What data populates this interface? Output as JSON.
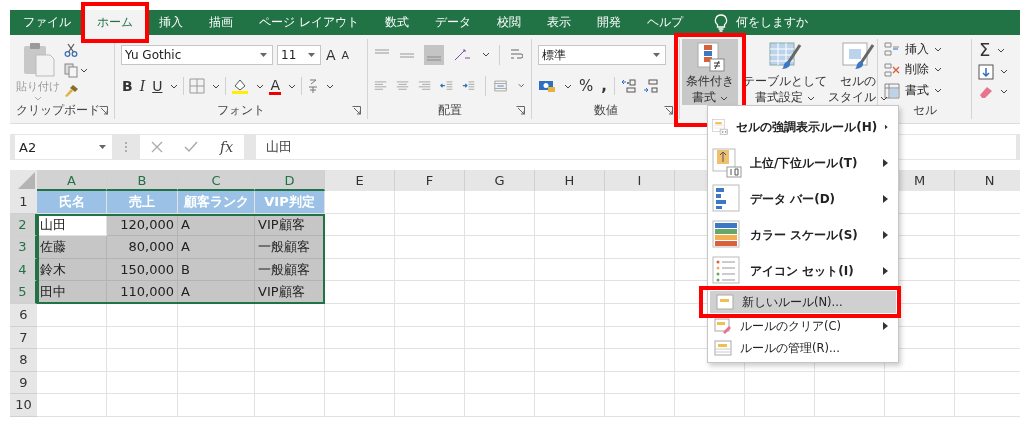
{
  "tabs": [
    {
      "label": "ファイル",
      "selected": false,
      "highlighted": false
    },
    {
      "label": "ホーム",
      "selected": true,
      "highlighted": true
    },
    {
      "label": "挿入",
      "selected": false,
      "highlighted": false
    },
    {
      "label": "描画",
      "selected": false,
      "highlighted": false
    },
    {
      "label": "ページ レイアウト",
      "selected": false,
      "highlighted": false
    },
    {
      "label": "数式",
      "selected": false,
      "highlighted": false
    },
    {
      "label": "データ",
      "selected": false,
      "highlighted": false
    },
    {
      "label": "校閲",
      "selected": false,
      "highlighted": false
    },
    {
      "label": "表示",
      "selected": false,
      "highlighted": false
    },
    {
      "label": "開発",
      "selected": false,
      "highlighted": false
    },
    {
      "label": "ヘルプ",
      "selected": false,
      "highlighted": false
    }
  ],
  "tell_me": "何をしますか",
  "ribbon": {
    "clipboard": {
      "paste": "貼り付け",
      "label": "クリップボード"
    },
    "font": {
      "name": "Yu Gothic",
      "size": "11",
      "grow": "A",
      "shrink": "A",
      "bold": "B",
      "italic": "I",
      "underline": "U",
      "font_color": "A",
      "label": "フォント"
    },
    "alignment": {
      "label": "配置"
    },
    "number": {
      "format": "標準",
      "percent": "%",
      "comma": ",",
      "label": "数値"
    },
    "styles": [
      {
        "lines": [
          "条件付き",
          "書式"
        ],
        "selected": true,
        "highlighted": true
      },
      {
        "lines": [
          "テーブルとして",
          "書式設定"
        ],
        "selected": false,
        "highlighted": false
      },
      {
        "lines": [
          "セルの",
          "スタイル"
        ],
        "selected": false,
        "highlighted": false
      }
    ],
    "cells": {
      "items": [
        "挿入",
        "削除",
        "書式"
      ],
      "label": "セル"
    },
    "editing": {
      "sum": "Σ"
    }
  },
  "formula_bar": {
    "name_box": "A2",
    "fx": "fx",
    "value": "山田"
  },
  "sheet": {
    "columns_left": [
      {
        "label": "A",
        "selected": true
      },
      {
        "label": "B",
        "selected": true
      },
      {
        "label": "C",
        "selected": true
      },
      {
        "label": "D",
        "selected": true
      },
      {
        "label": "E",
        "selected": false
      },
      {
        "label": "F",
        "selected": false
      },
      {
        "label": "G",
        "selected": false
      },
      {
        "label": "H",
        "selected": false
      },
      {
        "label": "I",
        "selected": false
      }
    ],
    "columns_right": [
      {
        "label": "M",
        "selected": false
      },
      {
        "label": "N",
        "selected": false
      }
    ],
    "rows": [
      {
        "label": "1",
        "selected": false
      },
      {
        "label": "2",
        "selected": true
      },
      {
        "label": "3",
        "selected": true
      },
      {
        "label": "4",
        "selected": true
      },
      {
        "label": "5",
        "selected": true
      },
      {
        "label": "6",
        "selected": false
      },
      {
        "label": "7",
        "selected": false
      },
      {
        "label": "8",
        "selected": false
      },
      {
        "label": "9",
        "selected": false
      },
      {
        "label": "10",
        "selected": false
      }
    ],
    "table": {
      "right_aligned": [
        false,
        true,
        false,
        false
      ],
      "rows": [
        {
          "kind": "header",
          "cells": [
            {
              "text": "氏名",
              "active": false
            },
            {
              "text": "売上",
              "active": false
            },
            {
              "text": "顧客ランク",
              "active": false
            },
            {
              "text": "VIP判定",
              "active": false
            }
          ]
        },
        {
          "kind": "data",
          "cells": [
            {
              "text": "山田",
              "active": true
            },
            {
              "text": "120,000",
              "active": false
            },
            {
              "text": "A",
              "active": false
            },
            {
              "text": "VIP顧客",
              "active": false
            }
          ]
        },
        {
          "kind": "data",
          "cells": [
            {
              "text": "佐藤",
              "active": false
            },
            {
              "text": "80,000",
              "active": false
            },
            {
              "text": "A",
              "active": false
            },
            {
              "text": "一般顧客",
              "active": false
            }
          ]
        },
        {
          "kind": "data",
          "cells": [
            {
              "text": "鈴木",
              "active": false
            },
            {
              "text": "150,000",
              "active": false
            },
            {
              "text": "B",
              "active": false
            },
            {
              "text": "一般顧客",
              "active": false
            }
          ]
        },
        {
          "kind": "data",
          "cells": [
            {
              "text": "田中",
              "active": false
            },
            {
              "text": "110,000",
              "active": false
            },
            {
              "text": "A",
              "active": false
            },
            {
              "text": "VIP顧客",
              "active": false
            }
          ]
        }
      ]
    }
  },
  "menu": {
    "items": [
      {
        "kind": "large",
        "label": "セルの強調表示ルール(H)",
        "submenu": true,
        "selected": false,
        "highlighted": false
      },
      {
        "kind": "large",
        "label": "上位/下位ルール(T)",
        "submenu": true,
        "selected": false,
        "highlighted": false
      },
      {
        "kind": "large",
        "label": "データ バー(D)",
        "submenu": true,
        "selected": false,
        "highlighted": false
      },
      {
        "kind": "large",
        "label": "カラー スケール(S)",
        "submenu": true,
        "selected": false,
        "highlighted": false
      },
      {
        "kind": "large",
        "label": "アイコン セット(I)",
        "submenu": true,
        "selected": false,
        "highlighted": false
      },
      {
        "kind": "small",
        "label": "新しいルール(N)...",
        "submenu": false,
        "selected": true,
        "highlighted": true
      },
      {
        "kind": "small",
        "label": "ルールのクリア(C)",
        "submenu": true,
        "selected": false,
        "highlighted": false
      },
      {
        "kind": "small",
        "label": "ルールの管理(R)...",
        "submenu": false,
        "selected": false,
        "highlighted": false
      }
    ]
  }
}
